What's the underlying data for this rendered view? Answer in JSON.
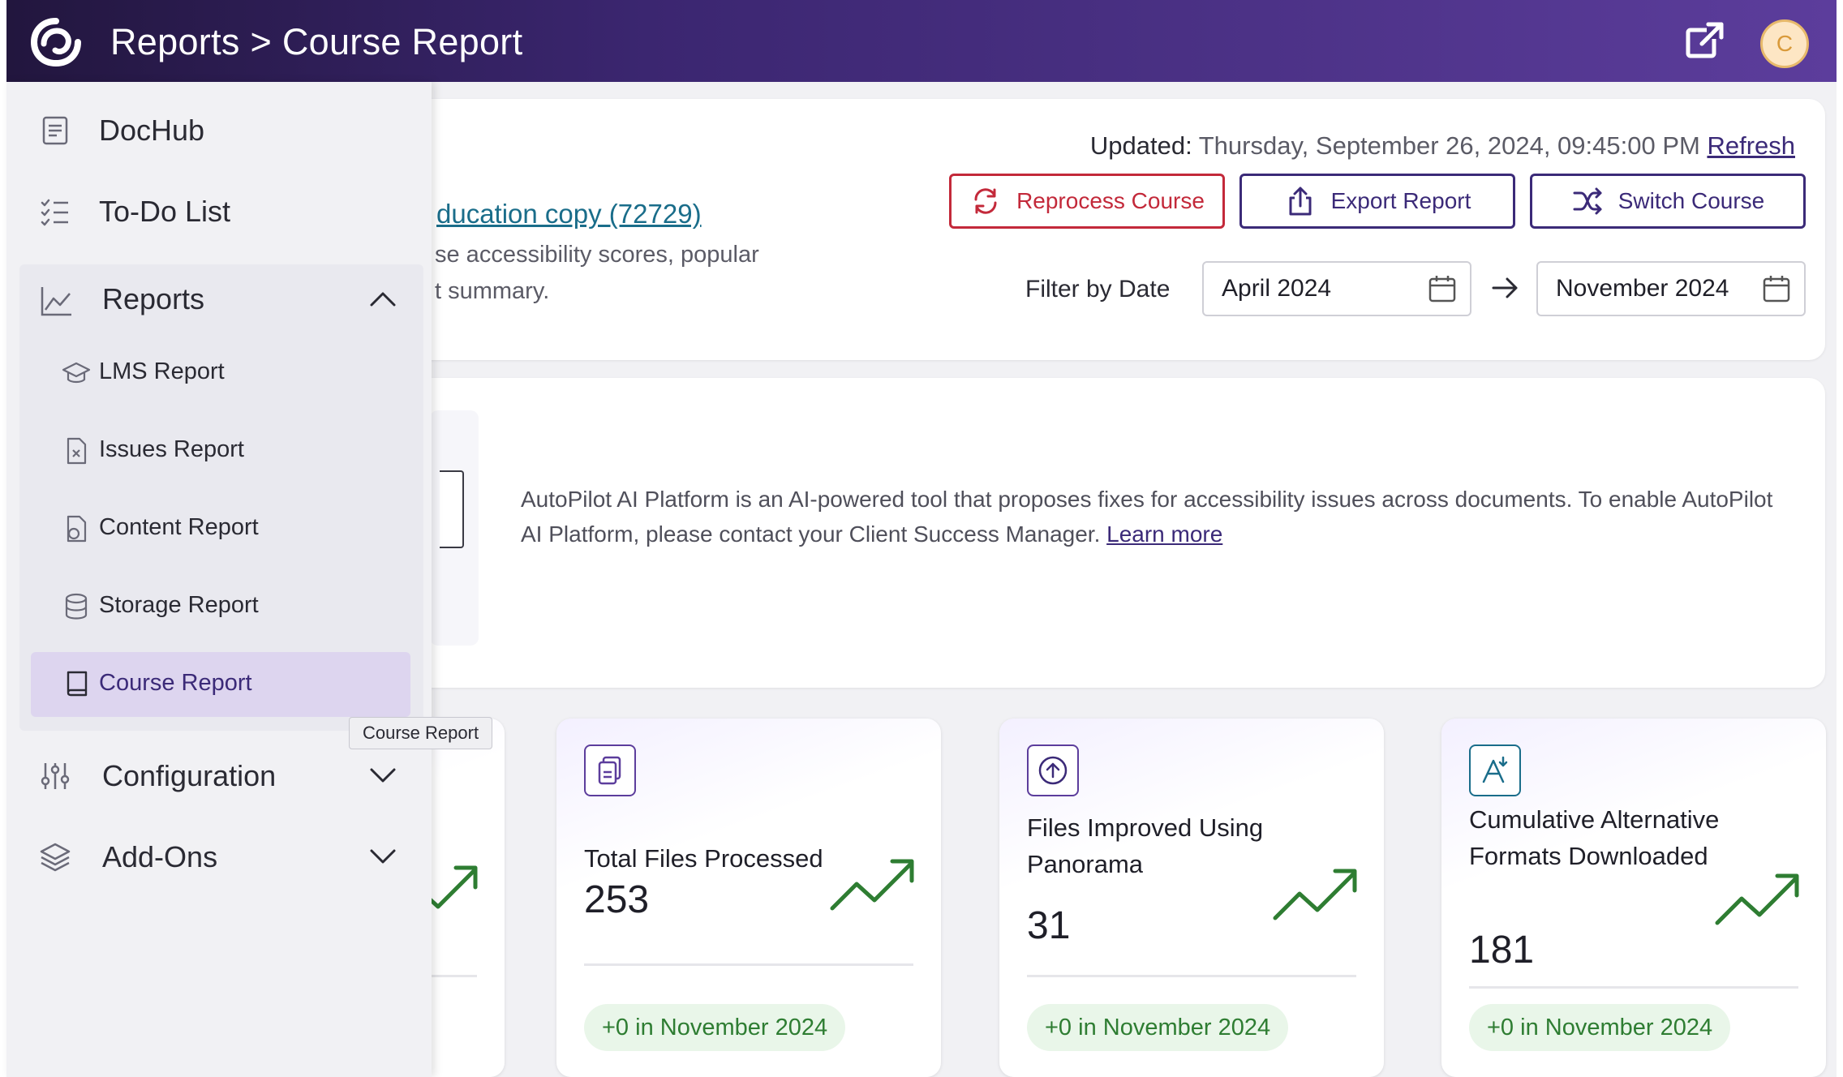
{
  "header": {
    "breadcrumb": "Reports > Course Report",
    "avatar_initial": "C",
    "brand_color": "#3b2670"
  },
  "top_card": {
    "updated_label": "Updated:",
    "updated_value": "Thursday, September 26, 2024, 09:45:00 PM",
    "refresh_label": "Refresh",
    "course_link": "ducation copy (72729)",
    "desc_line1": "se accessibility scores, popular",
    "desc_line2": "t summary.",
    "reprocess_label": "Reprocess Course",
    "export_label": "Export Report",
    "switch_label": "Switch Course",
    "filter_label": "Filter by Date",
    "date_start": "April 2024",
    "date_end": "November 2024"
  },
  "ai_card": {
    "text": "AutoPilot AI Platform is an AI-powered tool that proposes fixes for accessibility issues across documents. To enable AutoPilot AI Platform, please contact your Client Success Manager.",
    "learn_more": "Learn more"
  },
  "stats": [
    {
      "title": "Total Files Processed",
      "value": "253",
      "badge": "+0 in November 2024",
      "icon": "files-icon"
    },
    {
      "title": "Files Improved Using Panorama",
      "value": "31",
      "badge": "+0 in November 2024",
      "icon": "upload-circle-icon"
    },
    {
      "title": "Cumulative Alternative Formats Downloaded",
      "value": "181",
      "badge": "+0 in November 2024",
      "icon": "alt-format-icon"
    }
  ],
  "sidebar": {
    "dochub": "DocHub",
    "todo": "To-Do List",
    "reports": "Reports",
    "report_items": [
      "LMS Report",
      "Issues Report",
      "Content Report",
      "Storage Report",
      "Course Report"
    ],
    "configuration": "Configuration",
    "addons": "Add-Ons",
    "active_item": "Course Report"
  },
  "tooltip": "Course Report"
}
